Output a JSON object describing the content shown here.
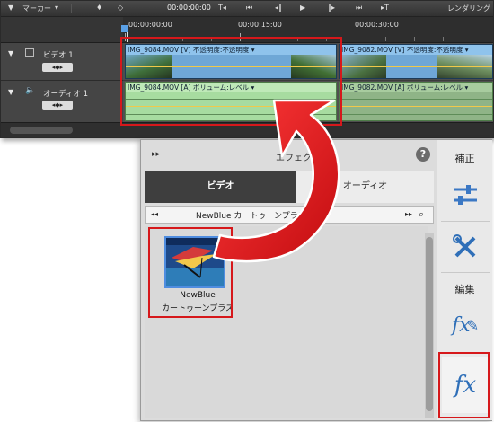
{
  "timeline": {
    "marker_label": "マーカー",
    "timecode": "00:00:00:00",
    "render_label": "レンダリング",
    "ruler": {
      "t0": "00:00:00:00",
      "t1": "00:00:15:00",
      "t2": "00:00:30:00"
    },
    "tracks": {
      "video": {
        "name": "ビデオ 1"
      },
      "audio": {
        "name": "オーディオ 1"
      }
    },
    "clips": {
      "video_a": {
        "label": "IMG_9084.MOV [V] 不透明度:不透明度 ▾"
      },
      "video_b": {
        "label": "IMG_9082.MOV [V] 不透明度:不透明度 ▾"
      },
      "audio_a": {
        "label": "IMG_9084.MOV [A] ボリューム:レベル ▾"
      },
      "audio_b": {
        "label": "IMG_9082.MOV [A] ボリューム:レベル ▾"
      }
    }
  },
  "effects_panel": {
    "title": "エフェクト",
    "tabs": {
      "video": "ビデオ",
      "audio": "オーディオ"
    },
    "category": "NewBlue カートゥーンプラス エ",
    "items": [
      {
        "name_line1": "NewBlue",
        "name_line2": "カートゥーンプラス"
      }
    ]
  },
  "right_rail": {
    "adjust_label": "補正",
    "edit_label": "編集",
    "fx_glyph": "fx"
  },
  "colors": {
    "highlight": "#d6181b",
    "video_clip": "#6fa7d6",
    "audio_clip": "#a7dca0",
    "tab_active": "#3e3e3e"
  }
}
